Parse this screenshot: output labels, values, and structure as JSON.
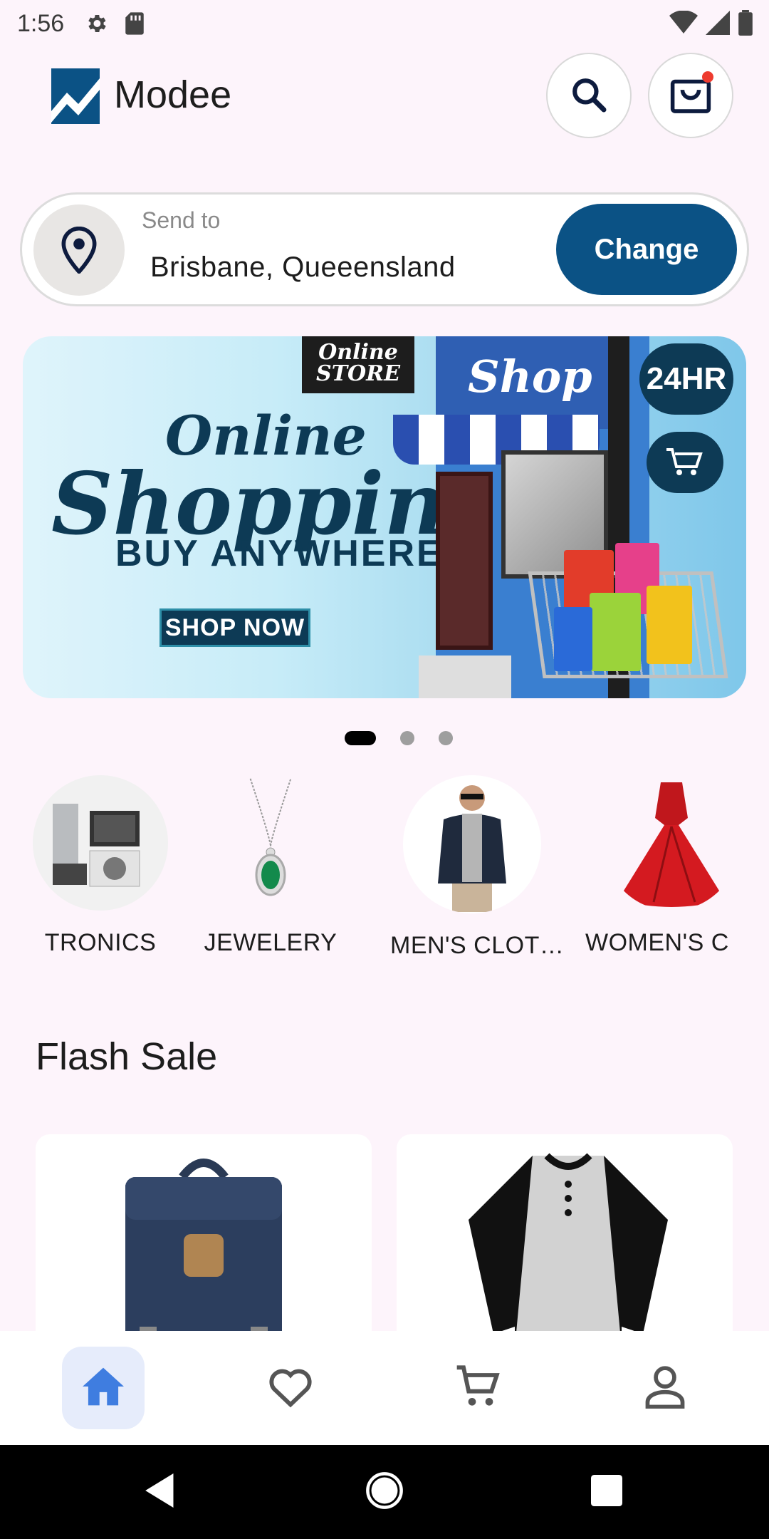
{
  "status_bar": {
    "time": "1:56",
    "icons": [
      "gear-icon",
      "sd-card-icon",
      "wifi-icon",
      "signal-icon",
      "battery-icon"
    ]
  },
  "app_bar": {
    "brand": "Modee",
    "search_icon": "search-icon",
    "bag_icon": "shopping-bag-icon",
    "has_notification": true
  },
  "location": {
    "label": "Send to",
    "city": "Brisbane, Queeensland",
    "button": "Change"
  },
  "banner": {
    "line1": "Online",
    "line2": "Shopping",
    "line3": "BUY ANYWHERE",
    "cta": "SHOP NOW",
    "sign": "Online STORE",
    "shop_sign": "Shop",
    "hours": "24HR",
    "slides_total": 3,
    "active_slide": 1
  },
  "categories": [
    {
      "label": "TRONICS",
      "icon": "electronics-image"
    },
    {
      "label": "JEWELERY",
      "icon": "necklace-image"
    },
    {
      "label": "MEN'S CLOT…",
      "icon": "mens-clothing-image"
    },
    {
      "label": "WOMEN'S C",
      "icon": "red-dress-image"
    }
  ],
  "flash_sale": {
    "title": "Flash Sale",
    "products": [
      {
        "image": "backpack-image"
      },
      {
        "image": "raglan-henley-shirt-image"
      }
    ]
  },
  "bottom_nav": {
    "items": [
      "home",
      "favorites",
      "cart",
      "profile"
    ],
    "active": "home"
  },
  "colors": {
    "primary": "#0b5285",
    "background": "#fdf4fb",
    "nav_active": "#3f7de0",
    "notification": "#ee3b2f"
  }
}
